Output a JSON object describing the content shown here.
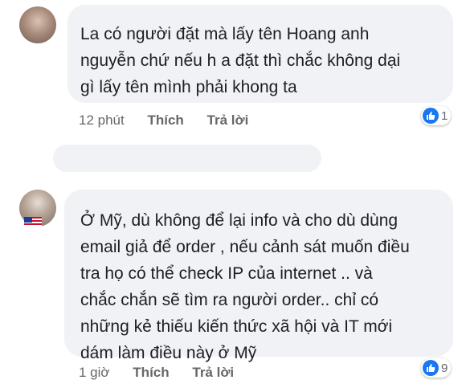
{
  "comments": [
    {
      "text": "La có người đặt mà lấy tên Hoang anh\nnguyễn chứ nếu  h a  đặt thì chắc không dại\ngì lấy tên mình phải khong ta",
      "time": "12 phút",
      "like_label": "Thích",
      "reply_label": "Trả lời",
      "reaction_icon": "like-icon",
      "reaction_count": "1"
    },
    {
      "text": "Ở Mỹ, dù không để lại info và cho dù dùng\nemail giả để order , nếu cảnh sát muốn điều\ntra họ có thể check IP của internet .. và\nchắc chắn sẽ tìm ra người  order.. chỉ có\nnhững kẻ thiếu kiến thức xã hội và IT mới\ndám làm điều này ở Mỹ",
      "time": "1 giờ",
      "like_label": "Thích",
      "reply_label": "Trả lời",
      "reaction_icon": "like-icon",
      "reaction_count": "9"
    }
  ],
  "colors": {
    "bubble": "#f0f2f5",
    "like_blue": "#1877f2",
    "meta_text": "#65676b"
  }
}
